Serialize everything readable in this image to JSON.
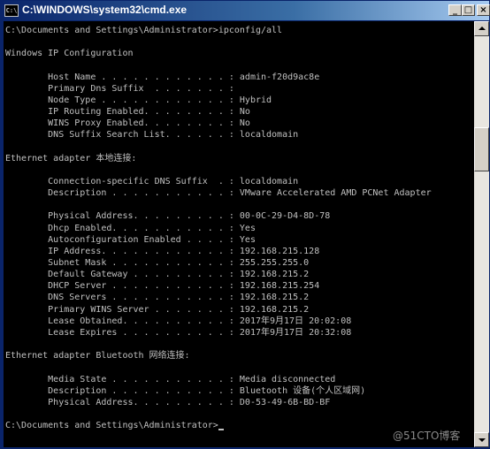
{
  "window": {
    "title": "C:\\WINDOWS\\system32\\cmd.exe",
    "icon": "cmd-icon",
    "buttons": {
      "minimize": "_",
      "maximize": "□",
      "close": "×"
    }
  },
  "console": {
    "lines": [
      "C:\\Documents and Settings\\Administrator>ipconfig/all",
      "",
      "Windows IP Configuration",
      "",
      "        Host Name . . . . . . . . . . . . : admin-f20d9ac8e",
      "        Primary Dns Suffix  . . . . . . . :",
      "        Node Type . . . . . . . . . . . . : Hybrid",
      "        IP Routing Enabled. . . . . . . . : No",
      "        WINS Proxy Enabled. . . . . . . . : No",
      "        DNS Suffix Search List. . . . . . : localdomain",
      "",
      "Ethernet adapter 本地连接:",
      "",
      "        Connection-specific DNS Suffix  . : localdomain",
      "        Description . . . . . . . . . . . : VMware Accelerated AMD PCNet Adapter",
      "",
      "        Physical Address. . . . . . . . . : 00-0C-29-D4-8D-78",
      "        Dhcp Enabled. . . . . . . . . . . : Yes",
      "        Autoconfiguration Enabled . . . . : Yes",
      "        IP Address. . . . . . . . . . . . : 192.168.215.128",
      "        Subnet Mask . . . . . . . . . . . : 255.255.255.0",
      "        Default Gateway . . . . . . . . . : 192.168.215.2",
      "        DHCP Server . . . . . . . . . . . : 192.168.215.254",
      "        DNS Servers . . . . . . . . . . . : 192.168.215.2",
      "        Primary WINS Server . . . . . . . : 192.168.215.2",
      "        Lease Obtained. . . . . . . . . . : 2017年9月17日 20:02:08",
      "        Lease Expires . . . . . . . . . . : 2017年9月17日 20:32:08",
      "",
      "Ethernet adapter Bluetooth 网络连接:",
      "",
      "        Media State . . . . . . . . . . . : Media disconnected",
      "        Description . . . . . . . . . . . : Bluetooth 设备(个人区域网)",
      "        Physical Address. . . . . . . . . : D0-53-49-6B-BD-BF",
      "",
      "C:\\Documents and Settings\\Administrator>"
    ]
  },
  "colors": {
    "console_bg": "#000000",
    "console_text": "#c0c0c0",
    "titlebar_start": "#0a246a",
    "titlebar_end": "#a6caf0"
  },
  "watermark": "@51CTO博客"
}
